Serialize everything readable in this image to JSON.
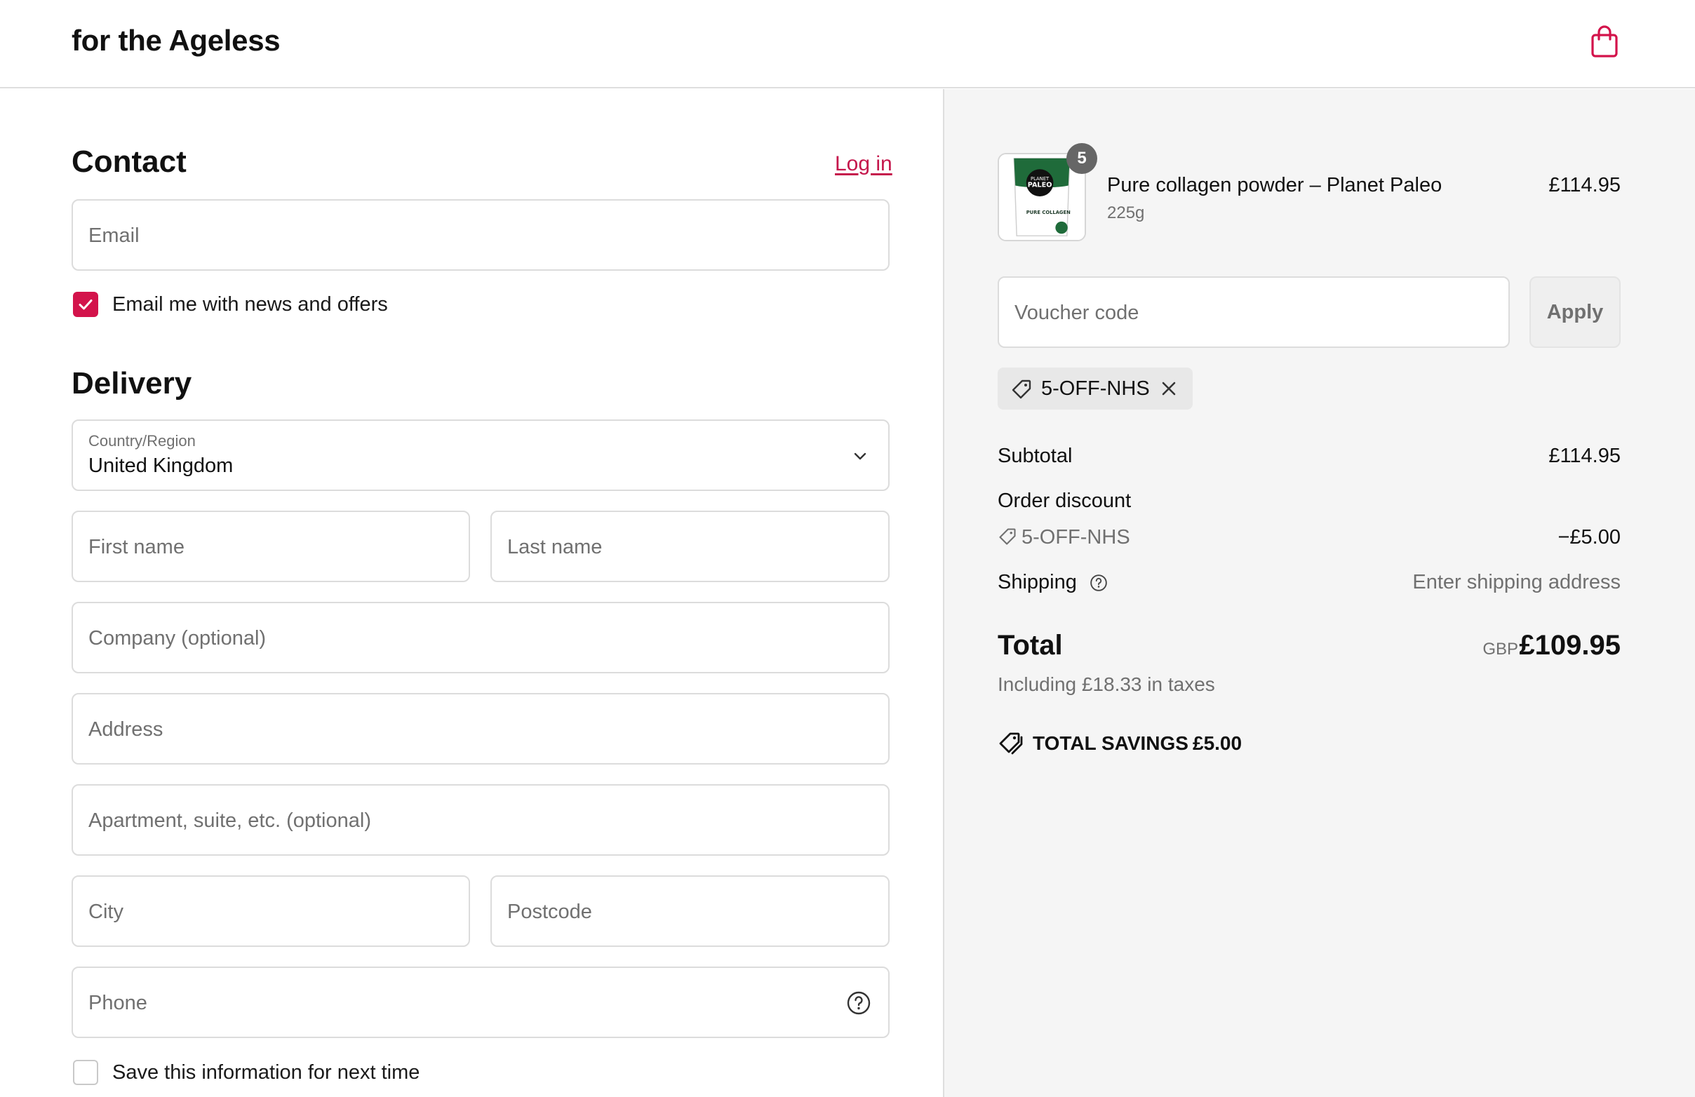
{
  "header": {
    "brand": "for the Ageless",
    "cart_icon": "shopping-bag-icon"
  },
  "contact": {
    "title": "Contact",
    "login_label": "Log in",
    "email_placeholder": "Email",
    "newsletter_label": "Email me with news and offers",
    "newsletter_checked": true
  },
  "delivery": {
    "title": "Delivery",
    "country_label": "Country/Region",
    "country_value": "United Kingdom",
    "first_name_placeholder": "First name",
    "last_name_placeholder": "Last name",
    "company_placeholder": "Company (optional)",
    "address_placeholder": "Address",
    "apartment_placeholder": "Apartment, suite, etc. (optional)",
    "city_placeholder": "City",
    "postcode_placeholder": "Postcode",
    "phone_placeholder": "Phone",
    "save_info_label": "Save this information for next time",
    "save_info_checked": false
  },
  "summary": {
    "product": {
      "name": "Pure collagen powder – Planet Paleo",
      "variant": "225g",
      "price": "£114.95",
      "quantity": "5",
      "image_label_top": "PLANET",
      "image_label_brand": "PALEO",
      "image_label_bottom": "PURE COLLAGEN"
    },
    "voucher_placeholder": "Voucher code",
    "apply_label": "Apply",
    "applied_code": "5-OFF-NHS",
    "subtotal_label": "Subtotal",
    "subtotal_value": "£114.95",
    "discount_label": "Order discount",
    "discount_code": "5-OFF-NHS",
    "discount_value": "−£5.00",
    "shipping_label": "Shipping",
    "shipping_value": "Enter shipping address",
    "total_label": "Total",
    "total_currency": "GBP",
    "total_value": "£109.95",
    "tax_note": "Including £18.33 in taxes",
    "savings_label": "TOTAL SAVINGS",
    "savings_value": "£5.00"
  },
  "colors": {
    "accent": "#d3134b",
    "link": "#c5174c",
    "summary_bg": "#f5f5f5"
  }
}
